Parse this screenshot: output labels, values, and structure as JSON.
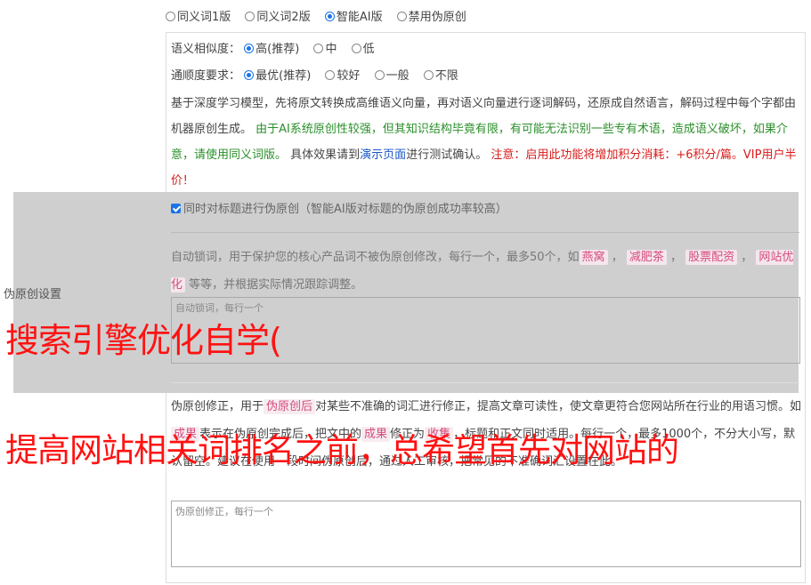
{
  "mode_options": [
    "同义词1版",
    "同义词2版",
    "智能AI版",
    "禁用伪原创"
  ],
  "mode_selected": 2,
  "similarity": {
    "label": "语义相似度：",
    "options": [
      "高(推荐)",
      "中",
      "低"
    ],
    "selected": 0
  },
  "fluency": {
    "label": "通顺度要求：",
    "options": [
      "最优(推荐)",
      "较好",
      "一般",
      "不限"
    ],
    "selected": 0
  },
  "ai_desc": {
    "part1": "基于深度学习模型，先将原文转换成高维语义向量，再对语义向量进行逐词解码，还原成自然语言，解码过程中每个字都由机器原创生成。",
    "green": "由于AI系统原创性较强，但其知识结构毕竟有限，有可能无法识别一些专有术语，造成语义破坏，如果介意，请使用同义词版。",
    "part2": "具体效果请到",
    "link": "演示页面",
    "part3": "进行测试确认。",
    "red": "注意：启用此功能将增加积分消耗：+6积分/篇。VIP用户半价！"
  },
  "settings_label": "伪原创设置",
  "title_checkbox": {
    "label": "同时对标题进行伪原创（智能AI版对标题的伪原创成功率较高）",
    "checked": true
  },
  "lock_words": {
    "desc1": "自动锁词，用于保护您的核心产品词不被伪原创修改，每行一个，最多50个，如",
    "examples": [
      "燕窝",
      "减肥茶",
      "股票配资",
      "网站优化"
    ],
    "desc2": "等等，并根据实际情况跟踪调整。",
    "placeholder": "自动锁词，每行一个"
  },
  "fix": {
    "desc1": "伪原创修正，用于",
    "tag": "伪原创后",
    "desc2": "对某些不准确的词汇进行修正，提高文章可读性，使文章更符合您网站所在行业的用语习惯。如",
    "ex1": "成果",
    "desc3": "表示在伪原创完成后，把文中的",
    "ex2": "成果",
    "desc4": "修正为",
    "ex3": "收集",
    "desc5": "，标题和正文同时适用。每行一个，最多1000个，不分大小写，默认留空。建议在使用一段时间伪原创后，通过人工审核，把常见的不准确词汇设置在此。",
    "placeholder": "伪原创修正，每行一个"
  },
  "overlay": {
    "line1": "搜索引擎优化自学(",
    "line2": "提高网站相关词排名之前，总希望首先对网站的"
  },
  "colors": {
    "accent": "#1a73e8",
    "green": "#2a8f2a",
    "red": "#d81b1b",
    "overlay": "#ff1212"
  }
}
